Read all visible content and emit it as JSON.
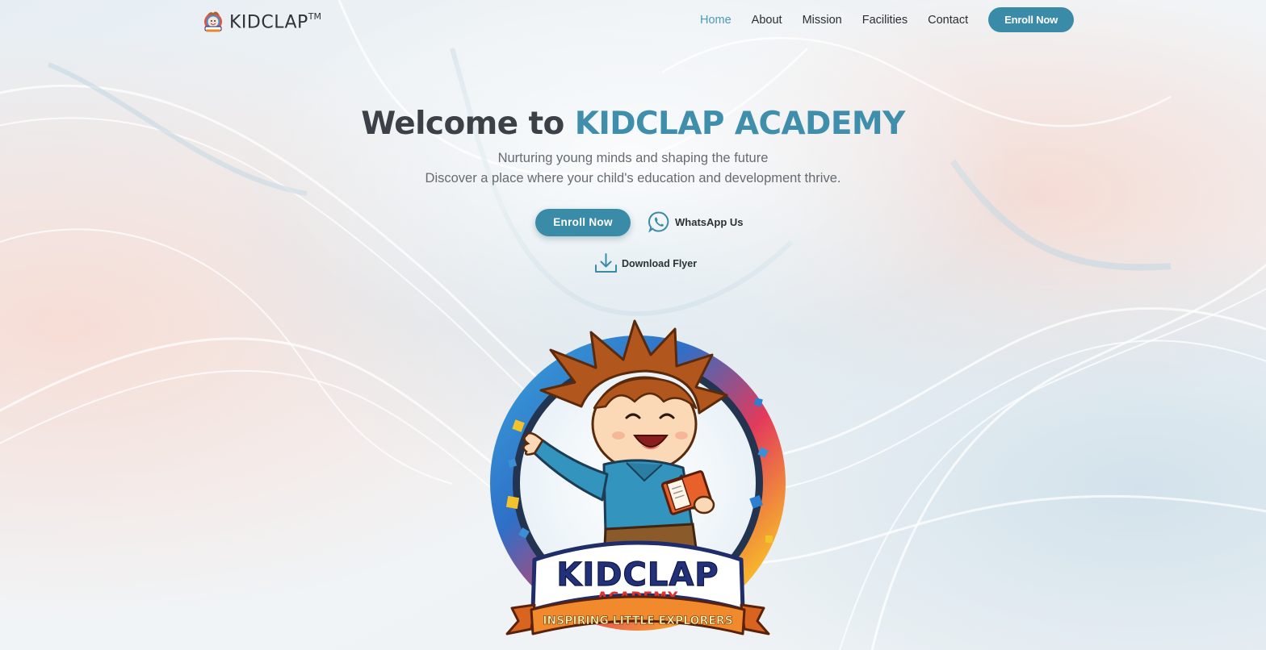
{
  "brand": {
    "name": "KIDCLAP",
    "trademark": "TM"
  },
  "nav": {
    "items": [
      {
        "label": "Home",
        "active": true
      },
      {
        "label": "About",
        "active": false
      },
      {
        "label": "Mission",
        "active": false
      },
      {
        "label": "Facilities",
        "active": false
      },
      {
        "label": "Contact",
        "active": false
      }
    ],
    "cta_label": "Enroll Now"
  },
  "hero": {
    "title_prefix": "Welcome to ",
    "title_accent": "KIDCLAP ACADEMY",
    "subtitle_line1": "Nurturing young minds and shaping the future",
    "subtitle_line2": "Discover a place where your child's education and development thrive.",
    "enroll_label": "Enroll Now",
    "whatsapp_label": "WhatsApp Us",
    "download_label": "Download Flyer"
  },
  "mascot": {
    "banner_title": "KIDCLAP",
    "banner_subtitle": "ACADEMY",
    "ribbon_text": "INSPIRING LITTLE EXPLORERS"
  },
  "colors": {
    "accent": "#3a8ba8",
    "title_accent": "#3f8fac",
    "nav_active": "#4a9ab8",
    "text_dark": "#2a2d31",
    "subtitle": "#666b70"
  },
  "icons": {
    "whatsapp": "whatsapp-icon",
    "download": "download-icon",
    "brand_logo": "kidclap-logo-icon"
  }
}
